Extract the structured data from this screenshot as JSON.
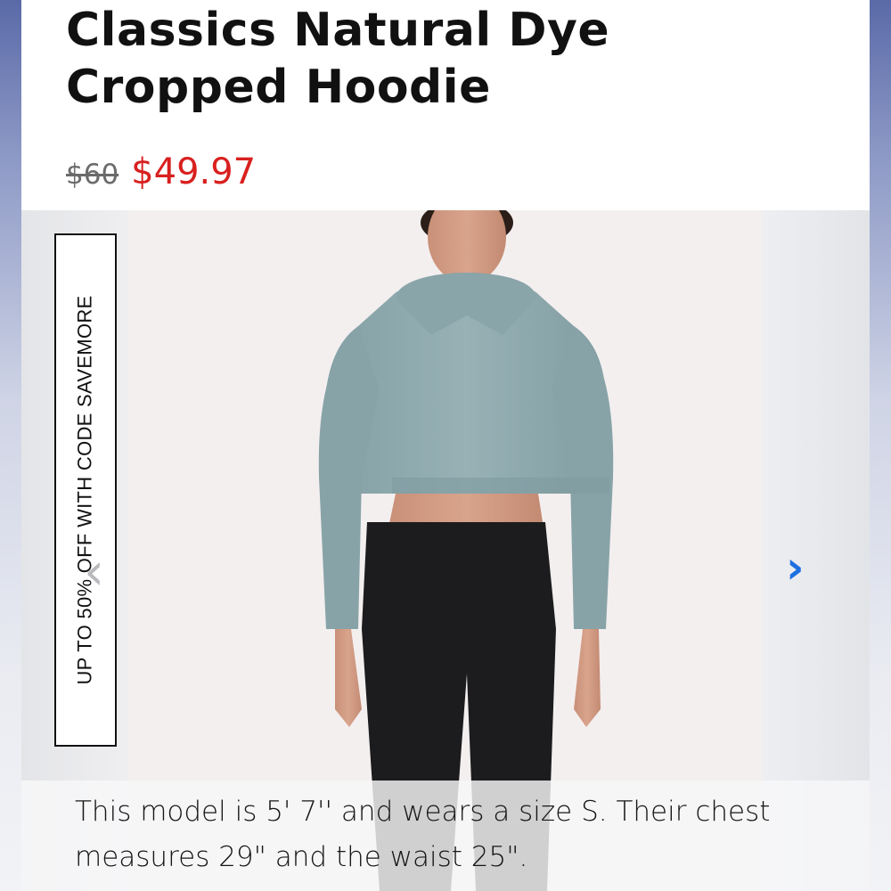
{
  "product": {
    "title_line1": "Classics Natural Dye",
    "title_line2": "Cropped Hoodie",
    "price_original": "$60",
    "price_sale": "$49.97"
  },
  "gallery": {
    "promo_text": "UP TO 50% OFF WITH CODE SAVEMORE",
    "prev_icon": "chevron-left-icon",
    "next_icon": "chevron-right-icon",
    "prev_glyph": "‹",
    "next_glyph": "›",
    "caption": "This model is 5' 7'' and wears a size S. Their chest measures 29\" and the waist 25\"."
  },
  "colors": {
    "sale_price": "#d8201f",
    "next_arrow": "#1e6fe0",
    "hoodie": "#8fa9ad",
    "leggings": "#1c1c1e"
  }
}
